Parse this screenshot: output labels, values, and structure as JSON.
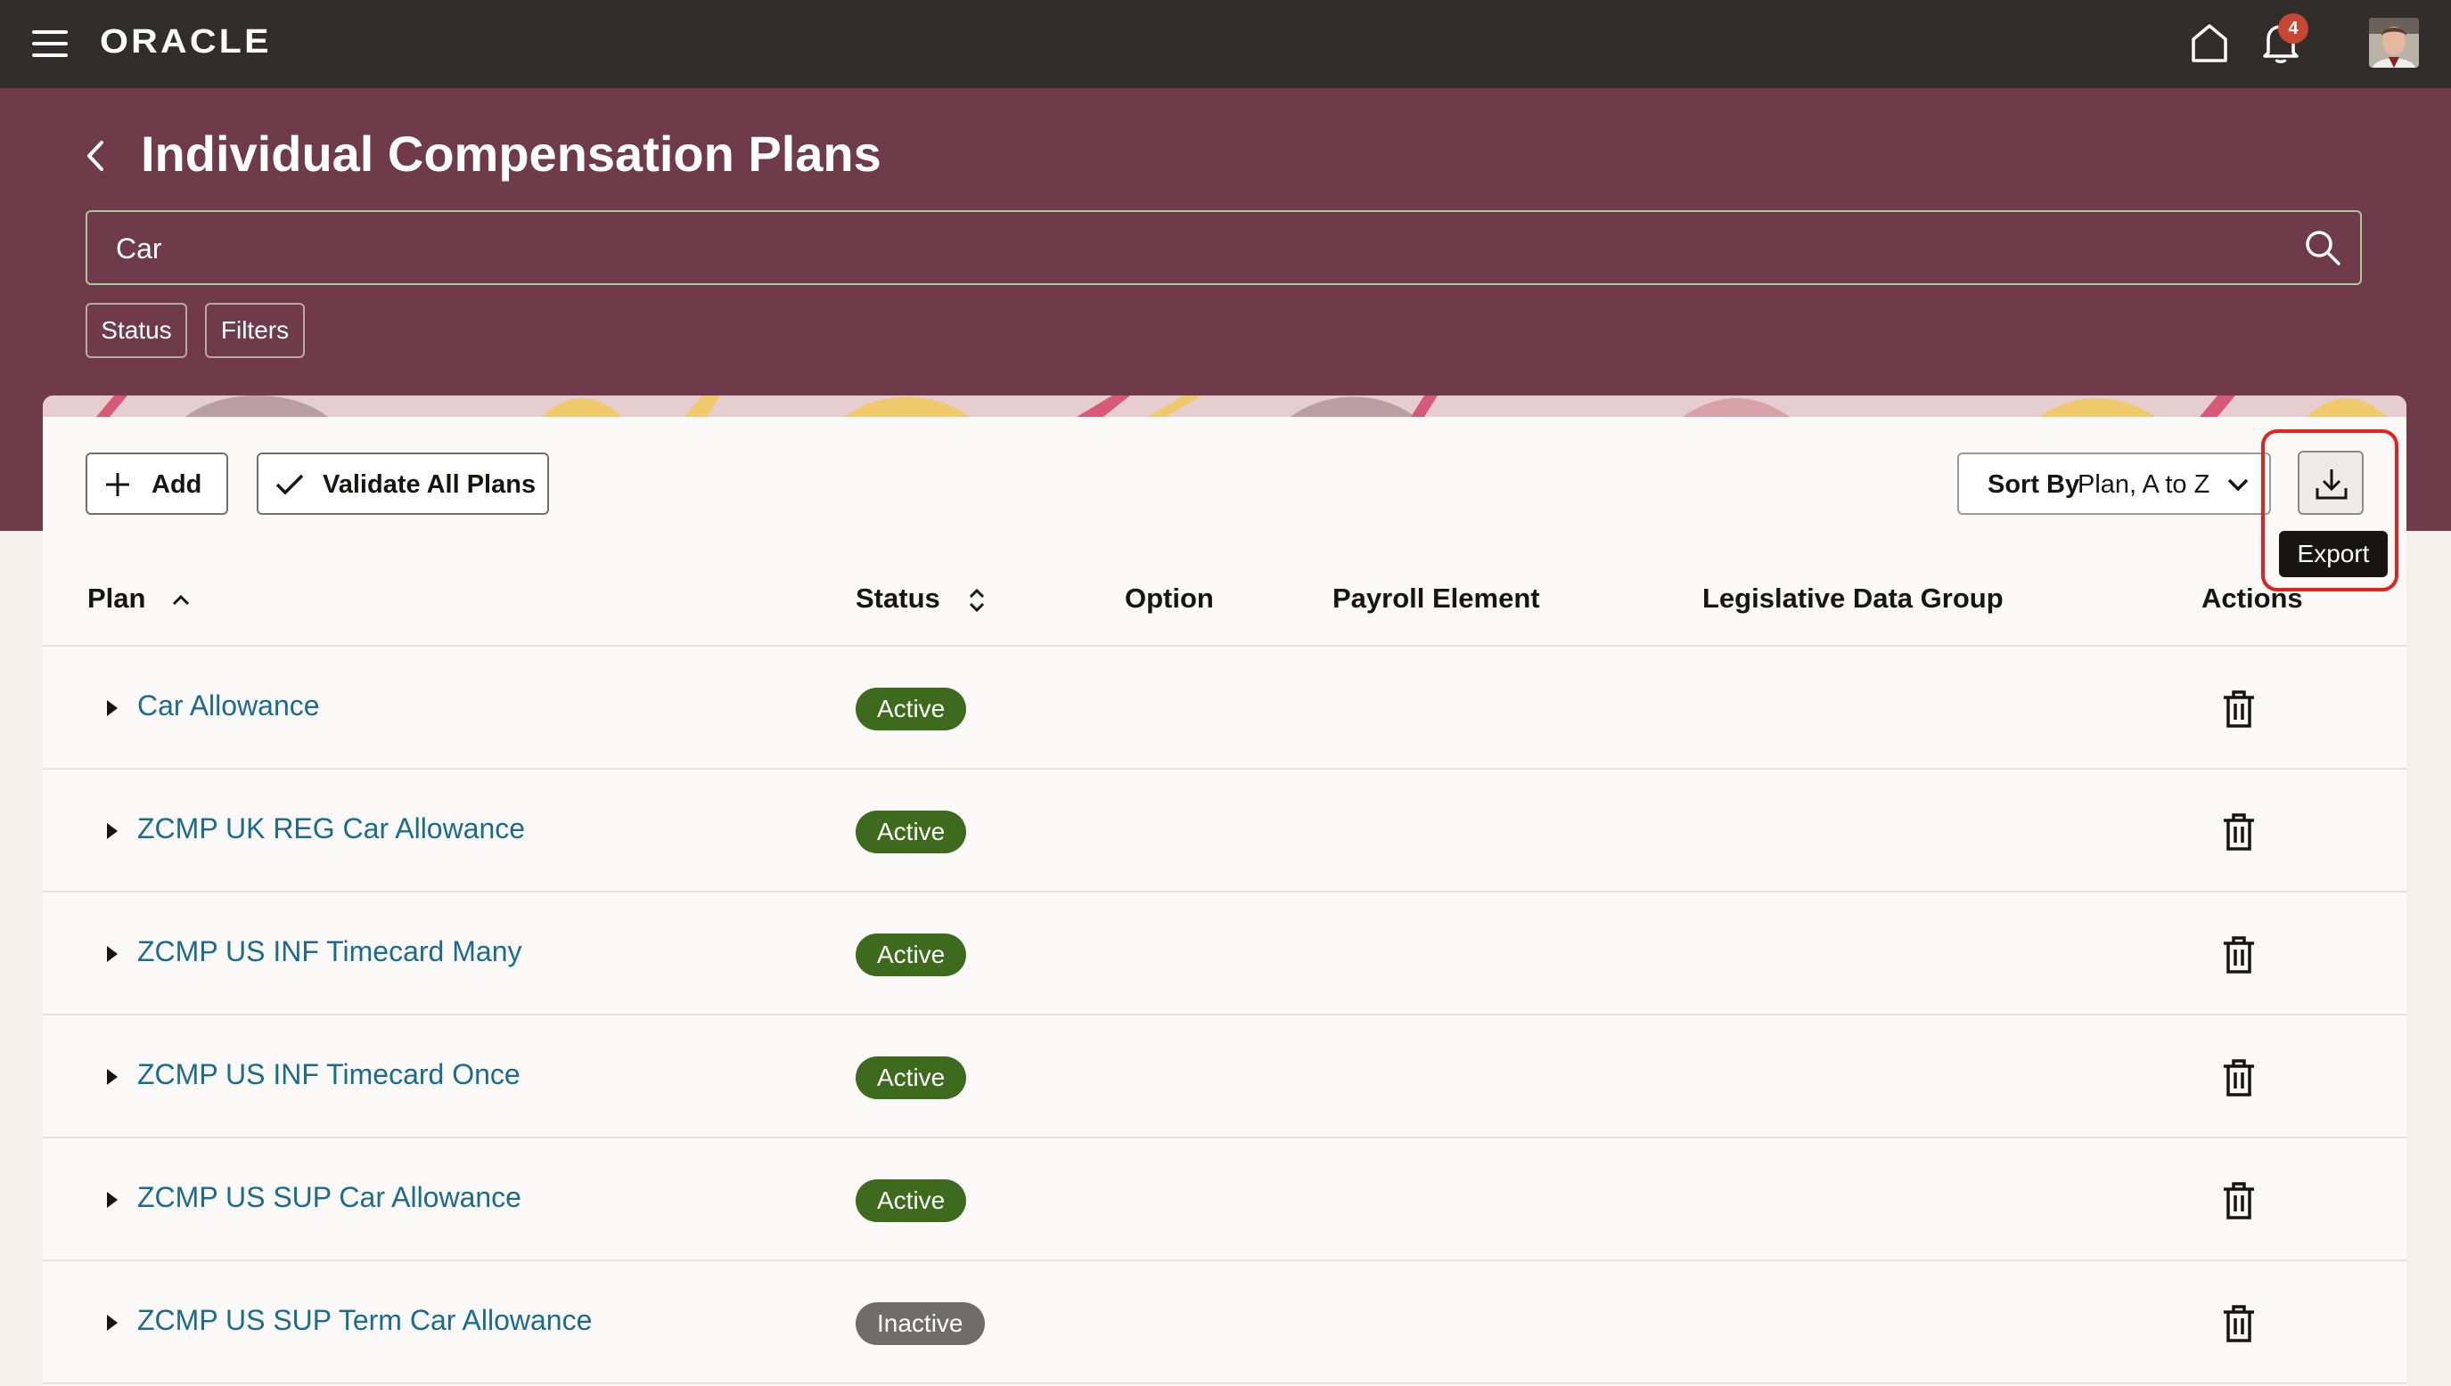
{
  "topbar": {
    "logo": "ORACLE",
    "notification_count": "4",
    "icons": [
      "hamburger-menu-icon",
      "home-icon",
      "bell-icon",
      "avatar"
    ]
  },
  "header": {
    "title": "Individual Compensation Plans",
    "search_value": "Car",
    "chips": [
      "Status",
      "Filters"
    ]
  },
  "toolbar": {
    "add_label": "Add",
    "validate_label": "Validate All Plans",
    "sort_prefix": "Sort By",
    "sort_value": "Plan, A to Z",
    "export_tooltip": "Export"
  },
  "table": {
    "columns": [
      "Plan",
      "Status",
      "Option",
      "Payroll Element",
      "Legislative Data Group",
      "Actions"
    ],
    "rows": [
      {
        "plan": "Car Allowance",
        "status": "Active"
      },
      {
        "plan": "ZCMP UK REG Car Allowance",
        "status": "Active"
      },
      {
        "plan": "ZCMP US INF Timecard Many",
        "status": "Active"
      },
      {
        "plan": "ZCMP US INF Timecard Once",
        "status": "Active"
      },
      {
        "plan": "ZCMP US SUP Car Allowance",
        "status": "Active"
      },
      {
        "plan": "ZCMP US SUP Term Car Allowance",
        "status": "Inactive"
      }
    ]
  },
  "colors": {
    "topbar": "#312d2a",
    "header_band": "#6f3b4a",
    "link": "#1a6b8c",
    "active_badge": "#3d6a1c",
    "inactive_badge": "#6f6d6a",
    "highlight": "#e0231c"
  }
}
